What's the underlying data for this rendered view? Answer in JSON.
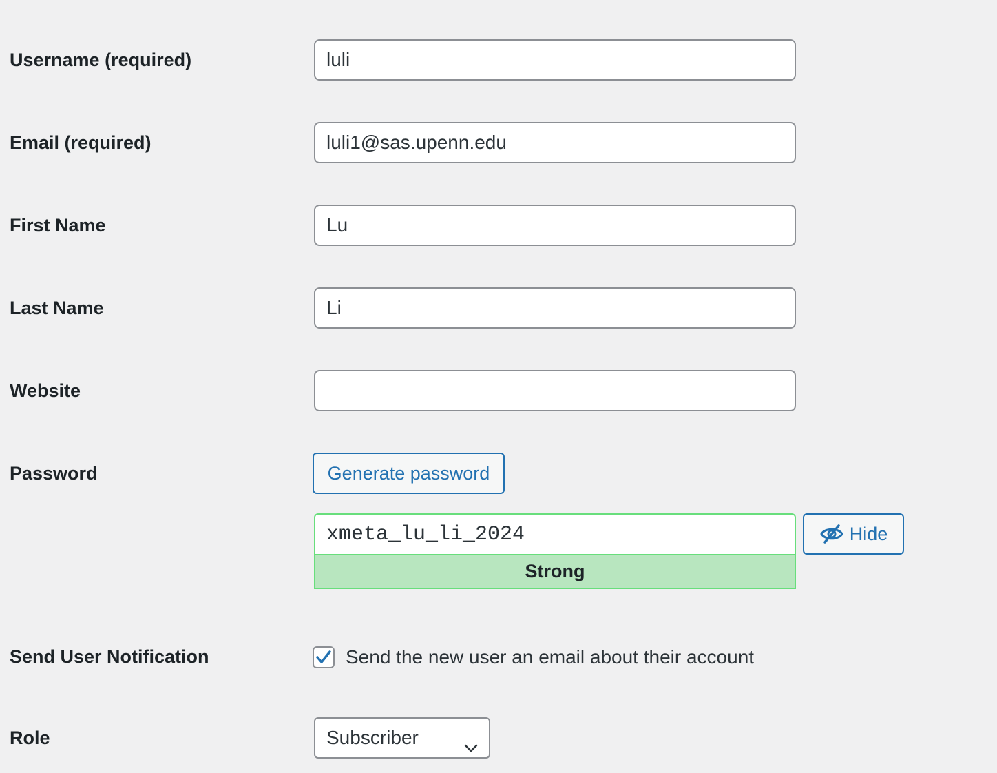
{
  "fields": {
    "username": {
      "label": "Username (required)",
      "value": "luli"
    },
    "email": {
      "label": "Email (required)",
      "value": "luli1@sas.upenn.edu"
    },
    "first_name": {
      "label": "First Name",
      "value": "Lu"
    },
    "last_name": {
      "label": "Last Name",
      "value": "Li"
    },
    "website": {
      "label": "Website",
      "value": ""
    }
  },
  "password": {
    "label": "Password",
    "generate_label": "Generate password",
    "value": "xmeta_lu_li_2024",
    "hide_label": "Hide",
    "strength": "Strong"
  },
  "notification": {
    "label": "Send User Notification",
    "checkbox_label": "Send the new user an email about their account",
    "checked": true
  },
  "role": {
    "label": "Role",
    "selected": "Subscriber"
  },
  "colors": {
    "background": "#f0f0f1",
    "accent": "#2271b1",
    "strong_bg": "#b8e6bf",
    "strong_border": "#68de7c"
  }
}
